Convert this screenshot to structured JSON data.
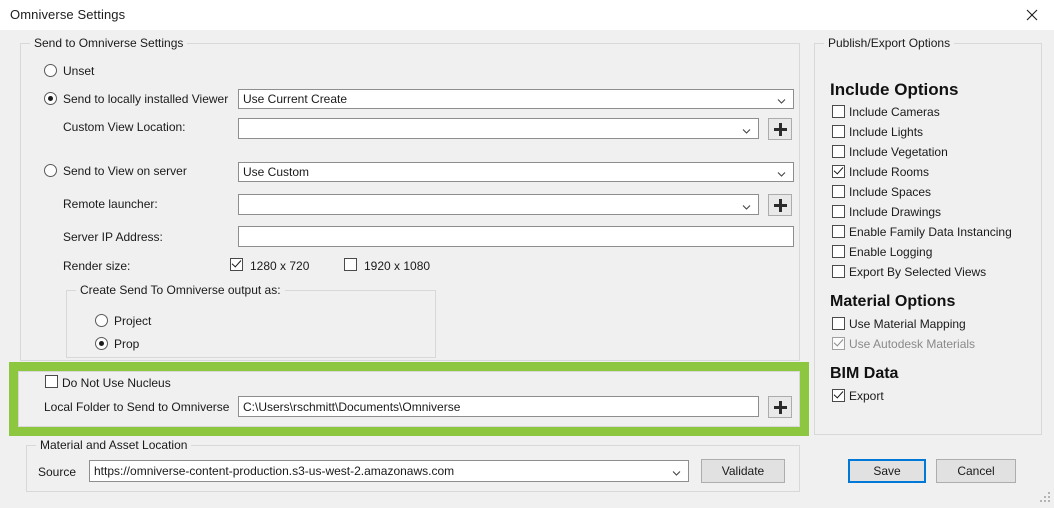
{
  "window": {
    "title": "Omniverse Settings",
    "close_icon": "close-icon"
  },
  "send_group": {
    "title": "Send to Omniverse Settings",
    "unset_label": "Unset",
    "unset_checked": false,
    "local_viewer_label": "Send to locally installed Viewer",
    "local_viewer_checked": true,
    "local_viewer_combo_value": "Use Current Create",
    "custom_view_label": "Custom View Location:",
    "custom_view_value": "",
    "custom_view_add_icon": "plus-icon",
    "server_view_label": "Send to View on server",
    "server_view_checked": false,
    "server_view_combo_value": "Use Custom",
    "remote_launcher_label": "Remote launcher:",
    "remote_launcher_value": "",
    "remote_launcher_add_icon": "plus-icon",
    "server_ip_label": "Server IP Address:",
    "server_ip_value": "",
    "render_size_label": "Render size:",
    "render_720_label": "1280 x 720",
    "render_720_checked": true,
    "render_1080_label": "1920 x 1080",
    "render_1080_checked": false,
    "output_group": {
      "title": "Create Send To Omniverse output as:",
      "project_label": "Project",
      "project_checked": false,
      "prop_label": "Prop",
      "prop_checked": true
    }
  },
  "nucleus": {
    "do_not_use_label": "Do Not Use Nucleus",
    "do_not_use_checked": false,
    "local_folder_label": "Local Folder to Send to Omniverse",
    "local_folder_value": "C:\\Users\\rschmitt\\Documents\\Omniverse",
    "local_folder_add_icon": "plus-icon",
    "highlight_color": "#8dc63f"
  },
  "material_group": {
    "title": "Material and Asset Location",
    "source_label": "Source",
    "source_value": "https://omniverse-content-production.s3-us-west-2.amazonaws.com",
    "validate_label": "Validate"
  },
  "publish_group": {
    "title": "Publish/Export Options",
    "include_heading": "Include Options",
    "include_items": [
      {
        "label": "Include Cameras",
        "checked": false,
        "disabled": false
      },
      {
        "label": "Include Lights",
        "checked": false,
        "disabled": false
      },
      {
        "label": "Include Vegetation",
        "checked": false,
        "disabled": false
      },
      {
        "label": "Include Rooms",
        "checked": true,
        "disabled": false
      },
      {
        "label": "Include Spaces",
        "checked": false,
        "disabled": false
      },
      {
        "label": "Include Drawings",
        "checked": false,
        "disabled": false
      },
      {
        "label": "Enable Family Data Instancing",
        "checked": false,
        "disabled": false
      },
      {
        "label": "Enable Logging",
        "checked": false,
        "disabled": false
      },
      {
        "label": "Export By Selected Views",
        "checked": false,
        "disabled": false
      }
    ],
    "material_heading": "Material Options",
    "material_items": [
      {
        "label": "Use Material Mapping",
        "checked": false,
        "disabled": false
      },
      {
        "label": "Use Autodesk Materials",
        "checked": true,
        "disabled": true
      }
    ],
    "bim_heading": "BIM Data",
    "bim_items": [
      {
        "label": "Export",
        "checked": true,
        "disabled": false
      }
    ]
  },
  "footer": {
    "save_label": "Save",
    "cancel_label": "Cancel",
    "accent_color": "#0078d7"
  }
}
